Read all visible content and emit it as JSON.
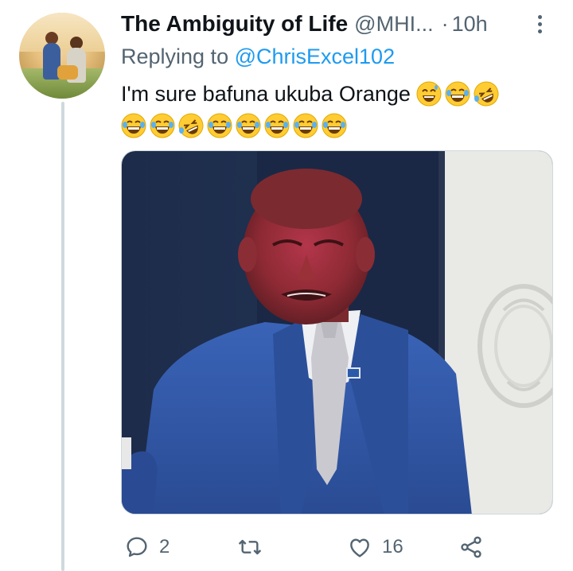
{
  "tweet": {
    "author_name": "The Ambiguity of Life",
    "author_handle": "@MHI...",
    "separator": "·",
    "time": "10h",
    "reply_prefix": "Replying to",
    "reply_to": "@ChrisExcel102",
    "text": "I'm sure bafuna ukuba Orange",
    "emojis_line1": [
      "grin-sweat-face-icon",
      "laughing-tears-face-icon",
      "rolling-laughing-face-icon"
    ],
    "emojis_line2": [
      "laughing-tears-face-icon",
      "laughing-tears-face-icon",
      "rolling-laughing-face-icon",
      "laughing-tears-face-icon",
      "laughing-tears-face-icon",
      "laughing-tears-face-icon",
      "laughing-tears-face-icon",
      "laughing-tears-face-icon"
    ]
  },
  "actions": {
    "reply_count": "2",
    "retweet_count": "",
    "like_count": "16"
  },
  "colors": {
    "accent": "#1d9bf0",
    "secondary_text": "#536471",
    "primary_text": "#0f1419"
  }
}
